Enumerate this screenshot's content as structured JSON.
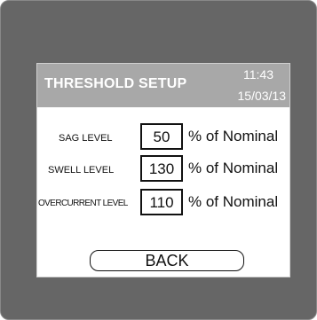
{
  "header": {
    "title": "THRESHOLD SETUP",
    "time": "11:43",
    "date": "15/03/13"
  },
  "rows": [
    {
      "label": "SAG LEVEL",
      "value": "50",
      "unit": "% of Nominal"
    },
    {
      "label": "SWELL LEVEL",
      "value": "130",
      "unit": "% of Nominal"
    },
    {
      "label": "OVERCURRENT LEVEL",
      "value": "110",
      "unit": "% of Nominal"
    }
  ],
  "back_label": "BACK"
}
